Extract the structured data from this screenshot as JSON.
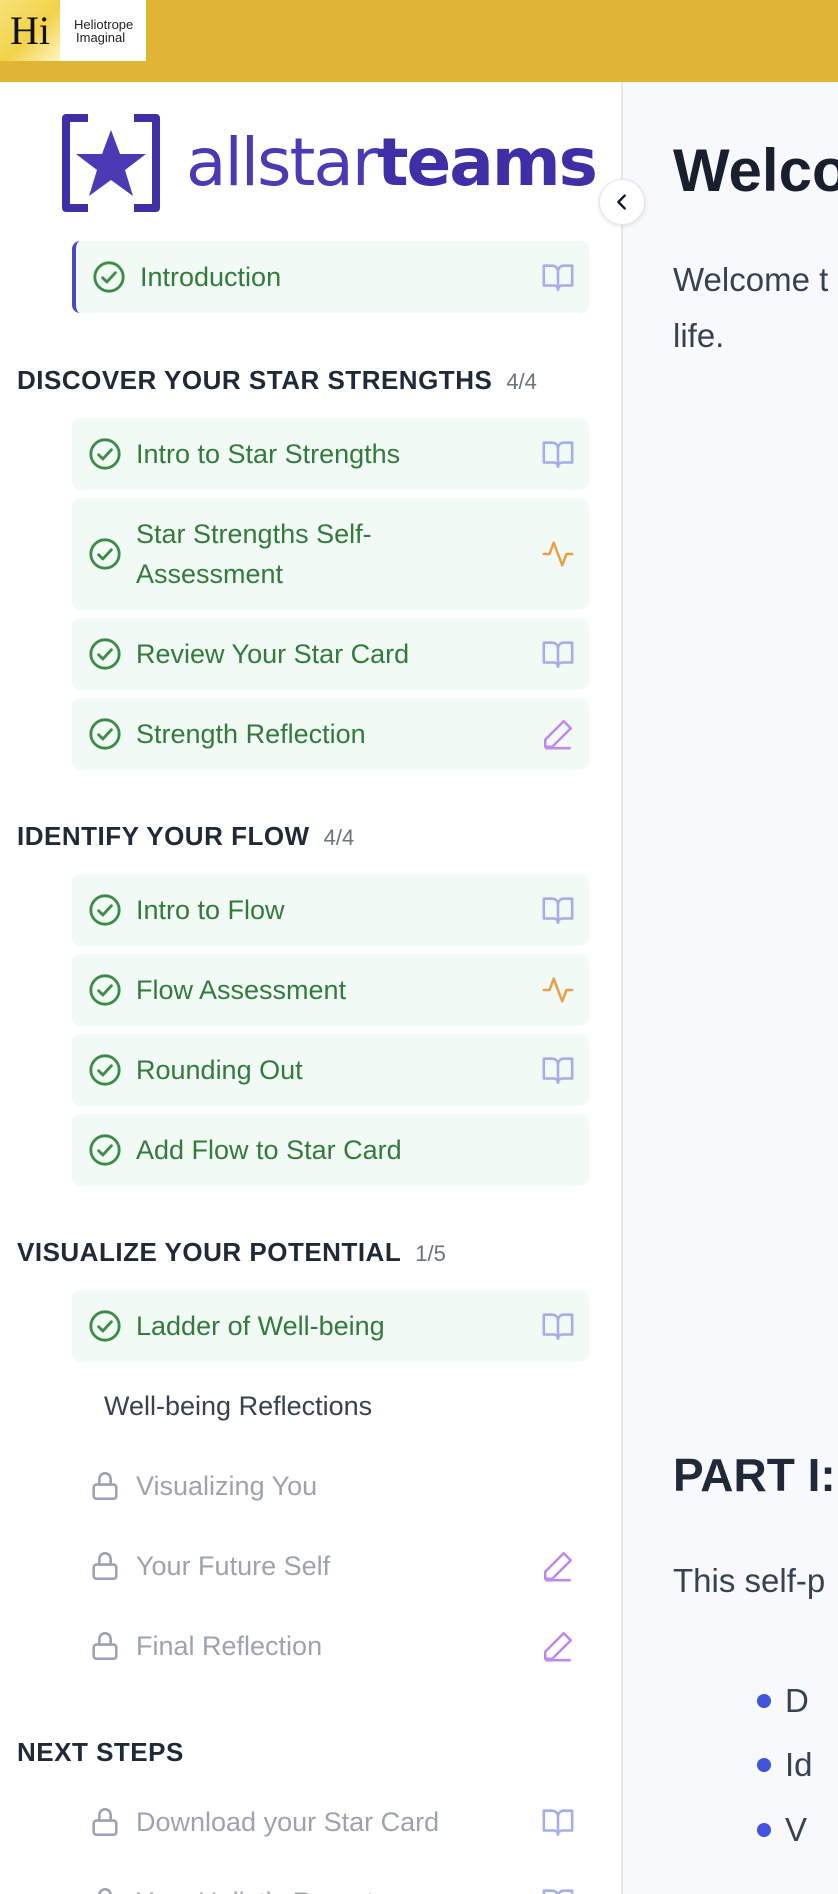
{
  "header": {
    "logo_mark": "Hi",
    "logo_line1": "Heliotrope",
    "logo_line2": "Imaginal"
  },
  "sidebar": {
    "brand": {
      "light": "allstar",
      "bold": "teams"
    },
    "intro": {
      "label": "Introduction",
      "icon": "book-icon"
    },
    "sections": [
      {
        "title": "DISCOVER YOUR STAR STRENGTHS",
        "count": "4/4",
        "items": [
          {
            "label": "Intro to Star Strengths",
            "icon": "book-icon"
          },
          {
            "label_line1": "Star Strengths Self-",
            "label_line2": "Assessment",
            "icon": "activity-icon"
          },
          {
            "label": "Review Your Star Card",
            "icon": "book-icon"
          },
          {
            "label": "Strength Reflection",
            "icon": "pencil-icon"
          }
        ]
      },
      {
        "title": "IDENTIFY YOUR FLOW",
        "count": "4/4",
        "items": [
          {
            "label": "Intro to Flow",
            "icon": "book-icon"
          },
          {
            "label": "Flow Assessment",
            "icon": "activity-icon"
          },
          {
            "label": "Rounding Out",
            "icon": "book-icon"
          },
          {
            "label": "Add Flow to Star Card"
          }
        ]
      },
      {
        "title": "VISUALIZE YOUR POTENTIAL",
        "count": "1/5",
        "items": [
          {
            "label": "Ladder of Well-being",
            "icon": "book-icon"
          },
          {
            "label": "Well-being Reflections"
          },
          {
            "label": "Visualizing You"
          },
          {
            "label": "Your Future Self",
            "icon": "pencil-icon"
          },
          {
            "label": "Final Reflection",
            "icon": "pencil-icon"
          }
        ]
      },
      {
        "title": "NEXT STEPS",
        "items": [
          {
            "label": "Download your Star Card",
            "icon": "book-icon"
          },
          {
            "label": "Your Holistic Report",
            "icon": "book-icon"
          }
        ]
      }
    ]
  },
  "main": {
    "title": "Welco",
    "intro_line1": "Welcome t",
    "intro_line2": "life.",
    "part_title": "PART I:",
    "part_text": "This self-p",
    "bullets": [
      "D",
      "Id",
      "V"
    ]
  },
  "colors": {
    "topbar": "#e0b434",
    "brand_purple": "#3e2fa6",
    "completed_green": "#347a3c",
    "completed_bg": "#f1faf5",
    "book_icon": "#a5aee8",
    "activity_icon": "#e8a04a",
    "pencil_icon": "#c08be8",
    "bullet_blue": "#4353e0"
  }
}
